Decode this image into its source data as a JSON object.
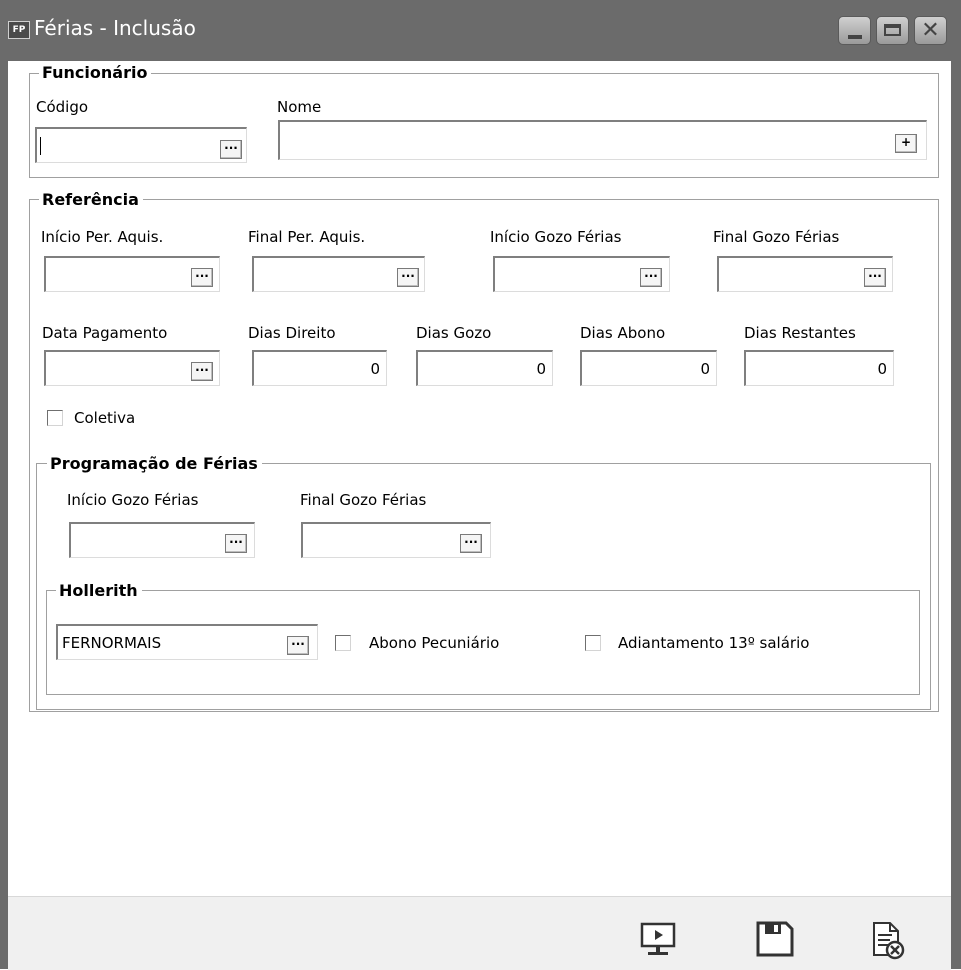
{
  "window": {
    "icon_text": "FP",
    "title": "Férias - Inclusão",
    "buttons": {
      "minimize": "minimize",
      "maximize": "maximize",
      "close": "close"
    }
  },
  "funcionario": {
    "legend": "Funcionário",
    "codigo_label": "Código",
    "codigo_value": "",
    "nome_label": "Nome",
    "nome_value": "",
    "add_button": "+"
  },
  "referencia": {
    "legend": "Referência",
    "inicio_per_aquis_label": "Início Per. Aquis.",
    "final_per_aquis_label": "Final Per. Aquis.",
    "inicio_gozo_label": "Início Gozo Férias",
    "final_gozo_label": "Final Gozo Férias",
    "data_pagamento_label": "Data Pagamento",
    "dias_direito_label": "Dias Direito",
    "dias_direito_value": "0",
    "dias_gozo_label": "Dias Gozo",
    "dias_gozo_value": "0",
    "dias_abono_label": "Dias Abono",
    "dias_abono_value": "0",
    "dias_restantes_label": "Dias Restantes",
    "dias_restantes_value": "0",
    "coletiva_label": "Coletiva",
    "coletiva_checked": false
  },
  "programacao": {
    "legend": "Programação de Férias",
    "inicio_gozo_label": "Início Gozo Férias",
    "final_gozo_label": "Final Gozo Férias"
  },
  "hollerith": {
    "legend": "Hollerith",
    "value": "FERNORMAIS",
    "abono_label": "Abono Pecuniário",
    "abono_checked": false,
    "adiantamento_label": "Adiantamento 13º salário",
    "adiantamento_checked": false
  },
  "lookup_button": "···",
  "toolbar": {
    "icons": [
      "preview-icon",
      "save-icon",
      "cancel-document-icon"
    ]
  },
  "colors": {
    "titlebar": "#6b6b6b",
    "toolbar": "#f0f0f0"
  }
}
